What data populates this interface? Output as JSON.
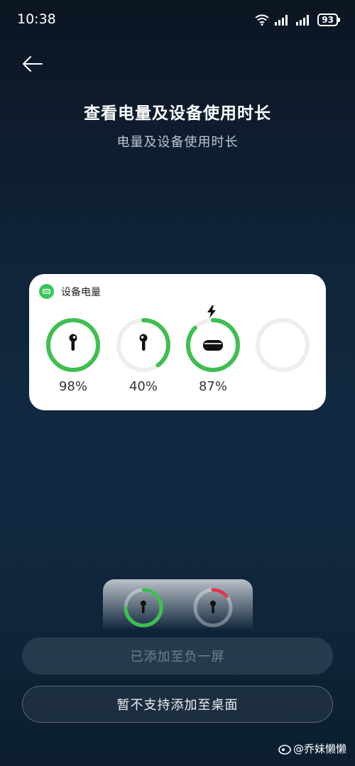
{
  "status_bar": {
    "time": "10:38",
    "battery": "93",
    "icons": [
      "wifi-icon",
      "signal-icon",
      "signal-icon",
      "battery-icon"
    ]
  },
  "header": {
    "back_icon": "arrow-left-icon",
    "title": "查看电量及设备使用时长",
    "subtitle": "电量及设备使用时长"
  },
  "widget": {
    "title": "设备电量",
    "app_icon": "battery-icon",
    "devices": [
      {
        "name_icon": "earbud-left-icon",
        "level": 0.98,
        "label": "98%",
        "charging": false
      },
      {
        "name_icon": "earbud-right-icon",
        "level": 0.4,
        "label": "40%",
        "charging": false
      },
      {
        "name_icon": "case-icon",
        "level": 0.87,
        "label": "87%",
        "charging": true
      },
      {
        "name_icon": "empty-slot",
        "level": 0,
        "label": "",
        "charging": false
      }
    ],
    "colors": {
      "ring": "#3fbf50",
      "track": "#eeeeee",
      "low": "#e2364a"
    }
  },
  "buttons": {
    "added": "已添加至负一屏",
    "not_supported": "暂不支持添加至桌面"
  },
  "watermark": "@乔妹懒懒"
}
